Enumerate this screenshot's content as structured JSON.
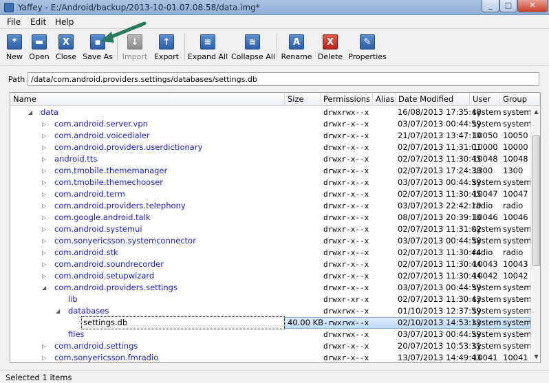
{
  "window": {
    "title": "Yaffey - E:/Android/backup/2013-10-01.07.08.58/data.img*"
  },
  "menu": [
    "File",
    "Edit",
    "Help"
  ],
  "toolbar": [
    {
      "label": "New",
      "icon": "new-icon",
      "glyph": "*",
      "style": "blue"
    },
    {
      "label": "Open",
      "icon": "open-icon",
      "glyph": "▬",
      "style": "blue"
    },
    {
      "label": "Close",
      "icon": "close-icon",
      "glyph": "X",
      "style": "blue"
    },
    {
      "label": "Save As",
      "icon": "save-icon",
      "glyph": "▪",
      "style": "blue"
    },
    {
      "label": "Import",
      "icon": "import-icon",
      "glyph": "↓",
      "style": "grey",
      "disabled": true
    },
    {
      "label": "Export",
      "icon": "export-icon",
      "glyph": "↑",
      "style": "blue"
    },
    {
      "label": "Expand All",
      "icon": "expand-all-icon",
      "glyph": "≡",
      "style": "blue"
    },
    {
      "label": "Collapse All",
      "icon": "collapse-all-icon",
      "glyph": "≡",
      "style": "blue"
    },
    {
      "label": "Rename",
      "icon": "rename-icon",
      "glyph": "A",
      "style": "blue"
    },
    {
      "label": "Delete",
      "icon": "delete-icon",
      "glyph": "X",
      "style": "red"
    },
    {
      "label": "Properties",
      "icon": "properties-icon",
      "glyph": "✎",
      "style": "blue"
    }
  ],
  "path": {
    "label": "Path",
    "value": "/data/com.android.providers.settings/databases/settings.db"
  },
  "columns": [
    "Name",
    "Size",
    "Permissions",
    "Alias",
    "Date Modified",
    "User",
    "Group"
  ],
  "rows": [
    {
      "name": "data",
      "level": 0,
      "toggle": "open",
      "size": "",
      "perm": "drwxrwx--x",
      "date": "16/08/2013 17:35:48",
      "user": "system",
      "group": "system"
    },
    {
      "name": "com.android.server.vpn",
      "level": 1,
      "toggle": "closed",
      "size": "",
      "perm": "drwxr-x--x",
      "date": "03/07/2013 00:44:59",
      "user": "system",
      "group": "system"
    },
    {
      "name": "com.android.voicedialer",
      "level": 1,
      "toggle": "closed",
      "size": "",
      "perm": "drwxr-x--x",
      "date": "21/07/2013 13:47:10",
      "user": "10050",
      "group": "10050"
    },
    {
      "name": "com.android.providers.userdictionary",
      "level": 1,
      "toggle": "closed",
      "size": "",
      "perm": "drwxr-x--x",
      "date": "02/07/2013 11:31:01",
      "user": "10000",
      "group": "10000"
    },
    {
      "name": "android.tts",
      "level": 1,
      "toggle": "closed",
      "size": "",
      "perm": "drwxr-x--x",
      "date": "02/07/2013 11:30:45",
      "user": "10048",
      "group": "10048"
    },
    {
      "name": "com.tmobile.thememanager",
      "level": 1,
      "toggle": "closed",
      "size": "",
      "perm": "drwxr-x--x",
      "date": "02/07/2013 17:24:38",
      "user": "1300",
      "group": "1300"
    },
    {
      "name": "com.tmobile.themechooser",
      "level": 1,
      "toggle": "closed",
      "size": "",
      "perm": "drwxr-x--x",
      "date": "03/07/2013 00:44:59",
      "user": "system",
      "group": "system"
    },
    {
      "name": "com.android.term",
      "level": 1,
      "toggle": "closed",
      "size": "",
      "perm": "drwxr-x--x",
      "date": "02/07/2013 11:30:45",
      "user": "10047",
      "group": "10047"
    },
    {
      "name": "com.android.providers.telephony",
      "level": 1,
      "toggle": "closed",
      "size": "",
      "perm": "drwxr-x--x",
      "date": "03/07/2013 22:42:10",
      "user": "radio",
      "group": "radio"
    },
    {
      "name": "com.google.android.talk",
      "level": 1,
      "toggle": "closed",
      "size": "",
      "perm": "drwxr-x--x",
      "date": "08/07/2013 20:39:10",
      "user": "10046",
      "group": "10046"
    },
    {
      "name": "com.android.systemui",
      "level": 1,
      "toggle": "closed",
      "size": "",
      "perm": "drwxr-x--x",
      "date": "02/07/2013 11:31:02",
      "user": "system",
      "group": "system"
    },
    {
      "name": "com.sonyericsson.systemconnector",
      "level": 1,
      "toggle": "closed",
      "size": "",
      "perm": "drwxr-x--x",
      "date": "03/07/2013 00:44:58",
      "user": "system",
      "group": "system"
    },
    {
      "name": "com.android.stk",
      "level": 1,
      "toggle": "closed",
      "size": "",
      "perm": "drwxr-x--x",
      "date": "02/07/2013 11:30:44",
      "user": "radio",
      "group": "radio"
    },
    {
      "name": "com.android.soundrecorder",
      "level": 1,
      "toggle": "closed",
      "size": "",
      "perm": "drwxr-x--x",
      "date": "02/07/2013 11:30:44",
      "user": "10043",
      "group": "10043"
    },
    {
      "name": "com.android.setupwizard",
      "level": 1,
      "toggle": "closed",
      "size": "",
      "perm": "drwxr-x--x",
      "date": "02/07/2013 11:30:44",
      "user": "10042",
      "group": "10042"
    },
    {
      "name": "com.android.providers.settings",
      "level": 1,
      "toggle": "open",
      "size": "",
      "perm": "drwxr-x--x",
      "date": "03/07/2013 00:44:59",
      "user": "system",
      "group": "system"
    },
    {
      "name": "lib",
      "level": 2,
      "toggle": "none",
      "size": "",
      "perm": "drwxr-xr-x",
      "date": "02/07/2013 11:30:43",
      "user": "system",
      "group": "system"
    },
    {
      "name": "databases",
      "level": 2,
      "toggle": "open",
      "size": "",
      "perm": "drwxrwx--x",
      "date": "01/10/2013 12:37:59",
      "user": "system",
      "group": "system"
    },
    {
      "name": "settings.db",
      "level": 3,
      "toggle": "none",
      "size": "40.00 KB",
      "perm": "-rwxrwx--x",
      "date": "02/10/2013 14:53:13",
      "user": "system",
      "group": "system",
      "selected": true
    },
    {
      "name": "files",
      "level": 2,
      "toggle": "none",
      "size": "",
      "perm": "drwxrwx--x",
      "date": "03/07/2013 00:44:59",
      "user": "system",
      "group": "system"
    },
    {
      "name": "com.android.settings",
      "level": 1,
      "toggle": "closed",
      "size": "",
      "perm": "drwxr-x--x",
      "date": "20/07/2013 10:53:31",
      "user": "system",
      "group": "system"
    },
    {
      "name": "com.sonyericsson.fmradio",
      "level": 1,
      "toggle": "closed",
      "size": "",
      "perm": "drwxr-x--x",
      "date": "13/07/2013 14:49:43",
      "user": "10041",
      "group": "10041"
    }
  ],
  "status": "Selected 1 items"
}
